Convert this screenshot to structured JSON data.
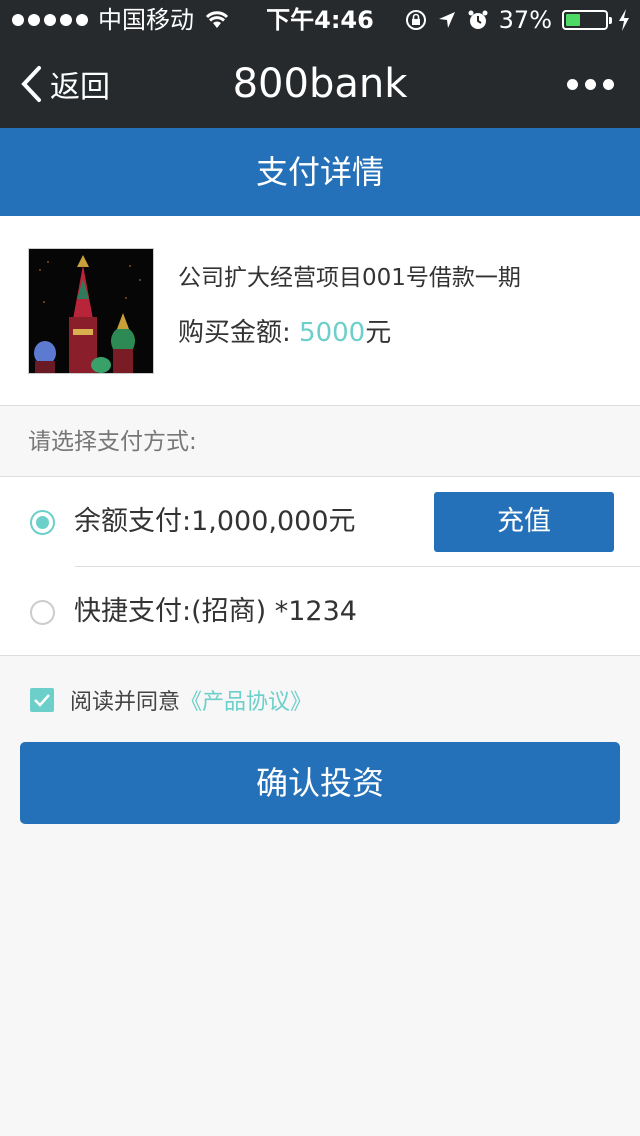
{
  "status_bar": {
    "carrier": "中国移动",
    "time": "下午4:46",
    "battery_percent_label": "37%",
    "battery_level": 0.37,
    "battery_color": "#4cd964",
    "icons": [
      "signal-dots-icon",
      "wifi-icon",
      "rotation-lock-icon",
      "location-arrow-icon",
      "alarm-icon",
      "battery-icon",
      "charging-bolt-icon"
    ]
  },
  "nav": {
    "back_label": "返回",
    "title": "800bank",
    "more_icon": "more-dots-icon"
  },
  "header": {
    "title": "支付详情",
    "background": "#2470b9"
  },
  "product": {
    "name": "公司扩大经营项目001号借款一期",
    "amount_label": "购买金额:",
    "amount_value": "5000",
    "amount_unit": "元",
    "accent_color": "#6ccfca"
  },
  "payment": {
    "hint": "请选择支付方式:",
    "options": [
      {
        "label": "余额支付:1,000,000元",
        "selected": true
      },
      {
        "label": "快捷支付:(招商) *1234",
        "selected": false
      }
    ],
    "recharge_label": "充值"
  },
  "agreement": {
    "checked": true,
    "text": "阅读并同意",
    "link": "《产品协议》"
  },
  "confirm_label": "确认投资"
}
